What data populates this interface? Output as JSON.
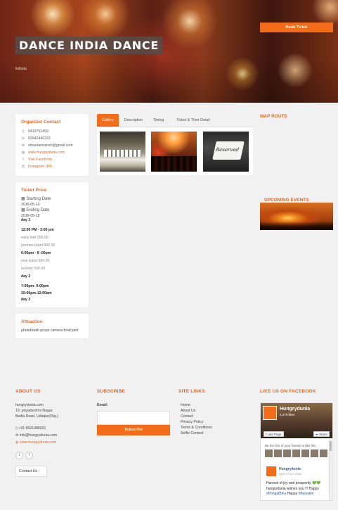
{
  "hero": {
    "title": "DANCE INDIA DANCE",
    "subtitle": "kolkata",
    "book_button": "Book Ticket"
  },
  "organizer": {
    "title": "Organizer Contact",
    "phone1": "9413752459",
    "phone2": "02942440322",
    "email": "shreetantransh@gmail.com",
    "website": "www.hungrydunia.com",
    "facebook": "Visit Facebook",
    "instagram": "Instagram URL"
  },
  "ticket_price": {
    "title": "Ticket Price",
    "starting_label": "Starting Date",
    "starting_date": "2016-05-10",
    "ending_label": "Ending Date",
    "ending_date": "2016-05-18",
    "lines": [
      "day 1",
      "12:00 PM - 3:00 pm",
      "early bird:200.00",
      "premier ticket:300.00",
      "6:00pm - 8 :00pm",
      "new ticket:500.00",
      "recliner:500.00",
      "day 2",
      "7:00pm- 9:00pm",
      "10:00pm-12:00am",
      "day 3"
    ]
  },
  "attraction": {
    "title": "Attraction",
    "text": "photobooth props camera food joint"
  },
  "tabs": [
    "Gallery",
    "Description",
    "Timing",
    "Ticket & Their Detail"
  ],
  "gallery": {
    "images": [
      "conference-room",
      "concert-crowd",
      "reserved-sign"
    ]
  },
  "sidebar": {
    "map_title": "MAP ROUTE",
    "upcoming_title": "UPCOMING EVENTS"
  },
  "footer": {
    "about": {
      "title": "ABOUT US",
      "name": "hungrydunia.com",
      "address1": "19, priyadarshni Nagar,",
      "address2": "Bedla Road, Udaipur(Raj.)",
      "phone": "+91 9521389201",
      "email": "info@hungrydunia.com",
      "website": "www.hungrydunia.com",
      "contact_button": "Contact Us"
    },
    "subscribe": {
      "title": "SUBSCRIBE",
      "email_label": "Email:",
      "button": "Subscribe"
    },
    "links": {
      "title": "SITE LINKS",
      "items": [
        "Home",
        "About Us",
        "Contact",
        "Privacy Policy",
        "Terms & Conditions",
        "Selfie Contest"
      ]
    },
    "facebook": {
      "title": "LIKE US ON FACEBOOK",
      "page_name": "Hungrydunia",
      "likes": "5,379 likes",
      "like_button": "Like Page",
      "share_button": "Share",
      "friends_text": "Be the first of your friends to like this",
      "post_name": "Hungrydunia",
      "post_date": "April 13 at 2:40am",
      "post_text": "Harvest of joy and prosperity 💚💚 hungrydunia wishes you !!! Happy",
      "post_tag1": "#PongalBihu",
      "post_happy": "Happy",
      "post_tag2": "#Baisakhi"
    }
  },
  "colors": {
    "accent": "#f26c1a"
  }
}
